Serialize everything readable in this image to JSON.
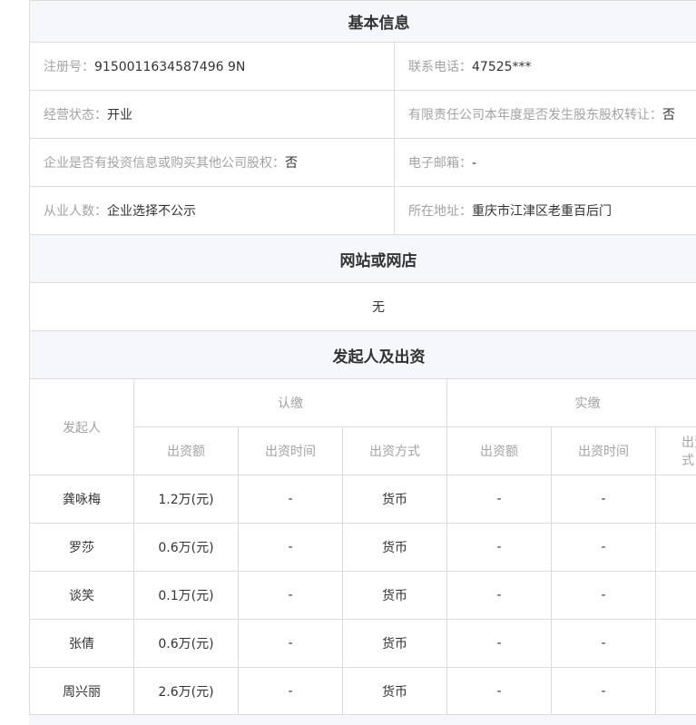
{
  "basic_info": {
    "title": "基本信息",
    "fields": [
      {
        "label": "注册号：",
        "value": "9150011634587496 9N"
      },
      {
        "label": "联系电话：",
        "value": "47525***"
      },
      {
        "label": "经营状态：",
        "value": "开业"
      },
      {
        "label": "有限责任公司本年度是否发生股东股权转让：",
        "value": "否"
      },
      {
        "label": "企业是否有投资信息或购买其他公司股权：",
        "value": "否"
      },
      {
        "label": "电子邮箱：",
        "value": "-"
      },
      {
        "label": "从业人数：",
        "value": "企业选择不公示"
      },
      {
        "label": "所在地址：",
        "value": "重庆市江津区老重百后门"
      }
    ]
  },
  "website": {
    "title": "网站或网店",
    "value": "无"
  },
  "investors": {
    "title": "发起人及出资",
    "col_investor": "发起人",
    "group_subscribed": "认缴",
    "group_paid": "实缴",
    "sub_headers": [
      "出资额",
      "出资时间",
      "出资方式",
      "出资额",
      "出资时间",
      "出资方式"
    ],
    "rows": [
      {
        "name": "龚咏梅",
        "sub_amount": "1.2万(元)",
        "sub_time": "-",
        "sub_method": "货币",
        "paid_amount": "-",
        "paid_time": "-",
        "paid_method": ""
      },
      {
        "name": "罗莎",
        "sub_amount": "0.6万(元)",
        "sub_time": "-",
        "sub_method": "货币",
        "paid_amount": "-",
        "paid_time": "-",
        "paid_method": ""
      },
      {
        "name": "谈笑",
        "sub_amount": "0.1万(元)",
        "sub_time": "-",
        "sub_method": "货币",
        "paid_amount": "-",
        "paid_time": "-",
        "paid_method": ""
      },
      {
        "name": "张倩",
        "sub_amount": "0.6万(元)",
        "sub_time": "-",
        "sub_method": "货币",
        "paid_amount": "-",
        "paid_time": "-",
        "paid_method": ""
      },
      {
        "name": "周兴丽",
        "sub_amount": "2.6万(元)",
        "sub_time": "-",
        "sub_method": "货币",
        "paid_amount": "-",
        "paid_time": "-",
        "paid_method": ""
      }
    ]
  }
}
